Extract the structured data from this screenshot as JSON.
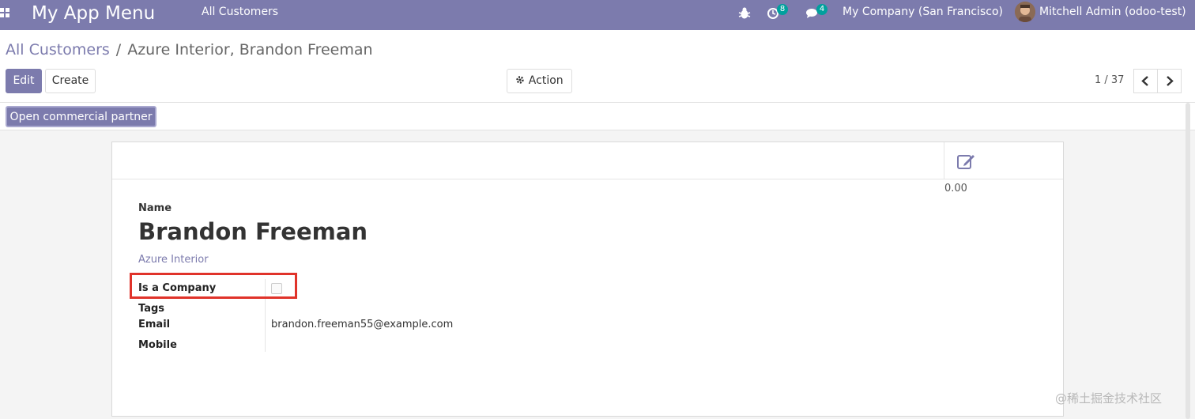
{
  "navbar": {
    "brand": "My App Menu",
    "menu_item": "All Customers",
    "activity_count": "8",
    "messages_count": "4",
    "company": "My Company (San Francisco)",
    "user": "Mitchell Admin (odoo-test)",
    "color": "#7c7bad"
  },
  "breadcrumb": {
    "parent": "All Customers",
    "separator": "/",
    "current": "Azure Interior, Brandon Freeman"
  },
  "toolbar": {
    "edit_label": "Edit",
    "create_label": "Create",
    "action_label": "Action",
    "action_icon": "gear-icon"
  },
  "pager": {
    "value": "1 / 37"
  },
  "statusbar": {
    "open_partner_label": "Open commercial partner"
  },
  "sheet": {
    "stat_value": "0.00",
    "stat_icon": "edit-icon",
    "name_label": "Name",
    "name_value": "Brandon Freeman",
    "parent_company": "Azure Interior",
    "fields": {
      "is_company_label": "Is a Company",
      "tags_label": "Tags",
      "email_label": "Email",
      "email_value": "brandon.freeman55@example.com",
      "mobile_label": "Mobile"
    }
  },
  "watermark": "@稀土掘金技术社区",
  "highlight_color": "#e0332a"
}
